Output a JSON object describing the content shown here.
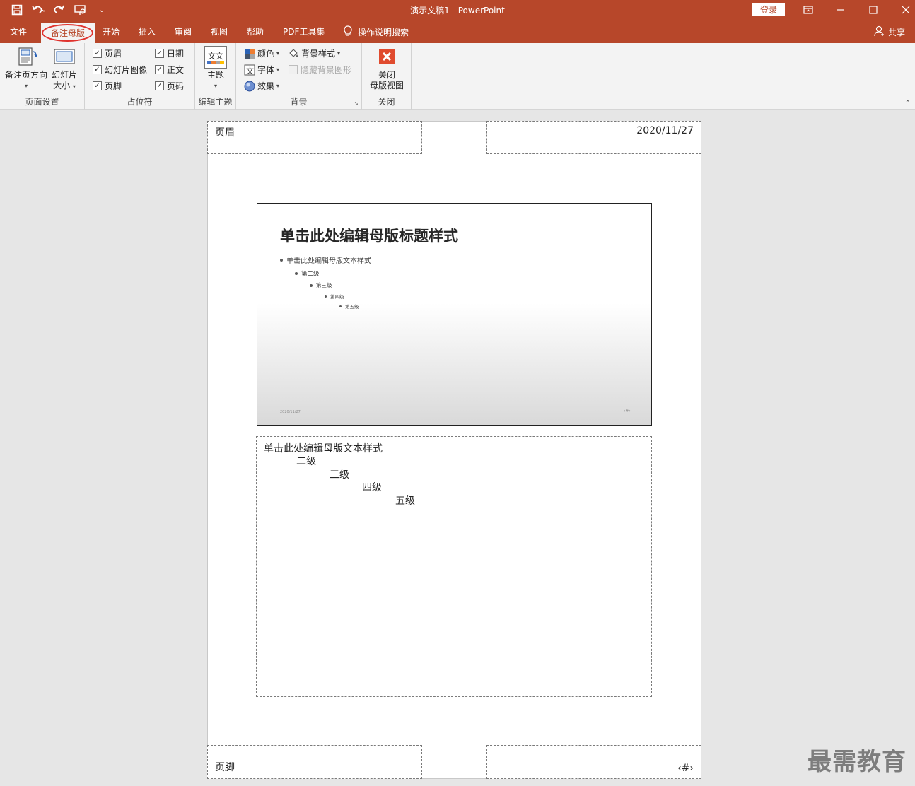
{
  "titlebar": {
    "title": "演示文稿1  -  PowerPoint",
    "login": "登录"
  },
  "tabs": [
    {
      "label": "文件"
    },
    {
      "label": "备注母版"
    },
    {
      "label": "开始"
    },
    {
      "label": "插入"
    },
    {
      "label": "审阅"
    },
    {
      "label": "视图"
    },
    {
      "label": "帮助"
    },
    {
      "label": "PDF工具集"
    }
  ],
  "tellme": "操作说明搜索",
  "share": "共享",
  "ribbon": {
    "page_setup": {
      "label": "页面设置",
      "orientation": "备注页方向",
      "slide_size_line1": "幻灯片",
      "slide_size_line2": "大小"
    },
    "placeholders": {
      "label": "占位符",
      "header": "页眉",
      "slide_image": "幻灯片图像",
      "footer": "页脚",
      "date": "日期",
      "body": "正文",
      "page_number": "页码"
    },
    "edit_theme": {
      "label": "编辑主题",
      "theme": "主题",
      "theme_icon_text": "文文"
    },
    "background": {
      "label": "背景",
      "colors": "颜色",
      "fonts": "字体",
      "effects": "效果",
      "bg_styles": "背景样式",
      "hide_bg": "隐藏背景图形"
    },
    "close": {
      "label": "关闭",
      "close_line1": "关闭",
      "close_line2": "母版视图"
    }
  },
  "notes_page": {
    "header": "页眉",
    "date": "2020/11/27",
    "footer": "页脚",
    "page_number": "‹#›",
    "slide": {
      "title": "单击此处编辑母版标题样式",
      "level1": "单击此处编辑母版文本样式",
      "level2": "第二级",
      "level3": "第三级",
      "level4": "第四级",
      "level5": "第五级",
      "date": "2020/11/27",
      "number": "‹#›"
    },
    "notes": {
      "level1": "单击此处编辑母版文本样式",
      "level2": "二级",
      "level3": "三级",
      "level4": "四级",
      "level5": "五级"
    }
  },
  "watermark": "最需教育",
  "colors": {
    "accent": "#b7472a",
    "highlight": "#e0332e"
  }
}
